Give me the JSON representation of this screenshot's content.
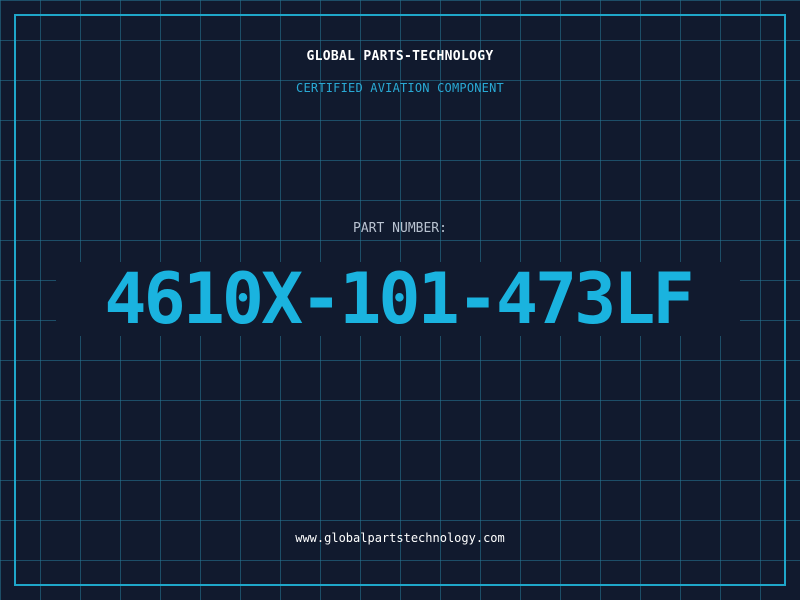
{
  "header": {
    "company": "GLOBAL PARTS-TECHNOLOGY",
    "tagline": "CERTIFIED AVIATION COMPONENT"
  },
  "part": {
    "label": "PART NUMBER:",
    "number": "4610X-101-473LF"
  },
  "footer": {
    "website": "www.globalpartstechnology.com"
  },
  "colors": {
    "background": "#111a2e",
    "grid": "#26789a",
    "border": "#1fa6c9",
    "accent": "#1ab3df",
    "tagline": "#29a9d4",
    "label": "#b9c2d0",
    "text": "#ffffff"
  }
}
